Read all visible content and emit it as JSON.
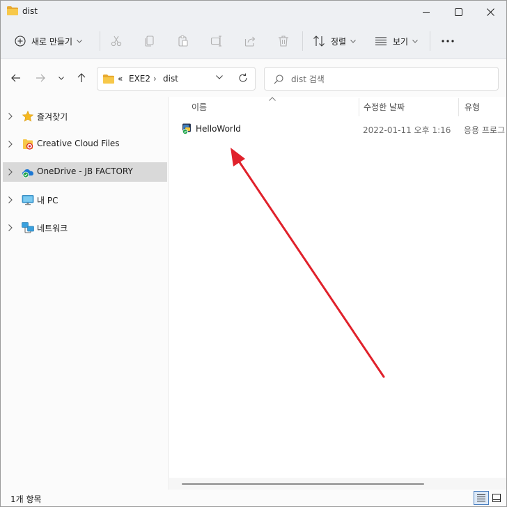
{
  "window": {
    "title": "dist"
  },
  "toolbar": {
    "new_label": "새로 만들기",
    "sort_label": "정렬",
    "view_label": "보기",
    "icons": [
      "cut-icon",
      "copy-icon",
      "paste-icon",
      "rename-icon",
      "share-icon",
      "delete-icon"
    ]
  },
  "address": {
    "overflow": "«",
    "crumbs": [
      "EXE2",
      "dist"
    ],
    "separator": "›"
  },
  "search": {
    "placeholder": "dist 검색"
  },
  "nav": {
    "items": [
      {
        "label": "즐겨찾기",
        "icon": "star-icon"
      },
      {
        "label": "Creative Cloud Files",
        "icon": "creative-cloud-folder-icon"
      },
      {
        "label": "OneDrive - JB FACTORY",
        "icon": "onedrive-icon",
        "selected": true
      },
      {
        "label": "내 PC",
        "icon": "pc-icon"
      },
      {
        "label": "네트워크",
        "icon": "network-icon"
      }
    ]
  },
  "columns": {
    "name": "이름",
    "date": "수정한 날짜",
    "type": "유형"
  },
  "files": [
    {
      "name": "HelloWorld",
      "date": "2022-01-11 오후 1:16",
      "type": "응용 프로그"
    }
  ],
  "status": {
    "count": "1개 항목"
  },
  "colors": {
    "annotation_arrow": "#e0212b",
    "selection": "#d9d9d9",
    "folder": "#f4c041"
  }
}
